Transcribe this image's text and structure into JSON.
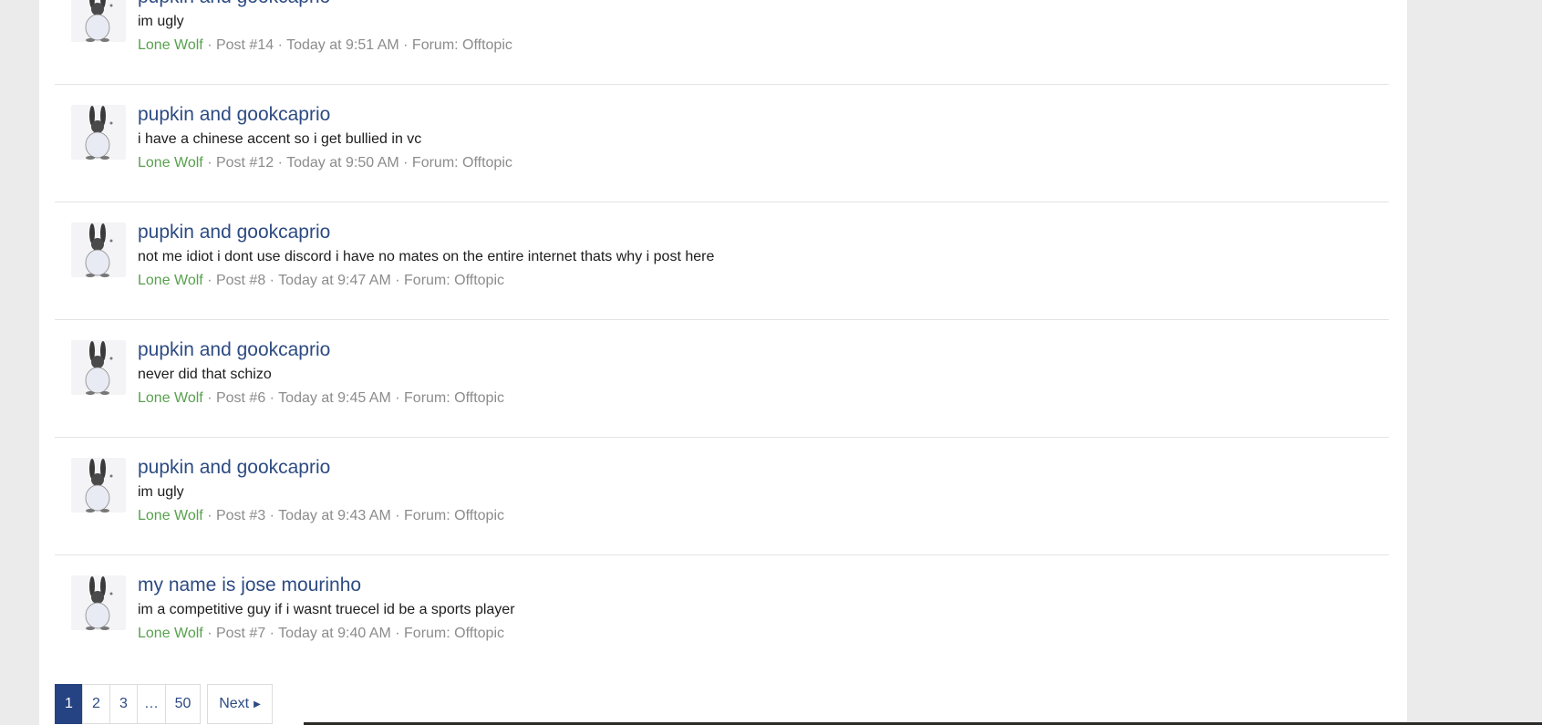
{
  "results": [
    {
      "title": "pupkin and gookcaprio",
      "snippet": "im ugly",
      "author": "Lone Wolf",
      "post": "Post #14",
      "time": "Today at 9:51 AM",
      "forum": "Forum: Offtopic"
    },
    {
      "title": "pupkin and gookcaprio",
      "snippet": "i have a chinese accent so i get bullied in vc",
      "author": "Lone Wolf",
      "post": "Post #12",
      "time": "Today at 9:50 AM",
      "forum": "Forum: Offtopic"
    },
    {
      "title": "pupkin and gookcaprio",
      "snippet": "not me idiot i dont use discord i have no mates on the entire internet thats why i post here",
      "author": "Lone Wolf",
      "post": "Post #8",
      "time": "Today at 9:47 AM",
      "forum": "Forum: Offtopic"
    },
    {
      "title": "pupkin and gookcaprio",
      "snippet": "never did that schizo",
      "author": "Lone Wolf",
      "post": "Post #6",
      "time": "Today at 9:45 AM",
      "forum": "Forum: Offtopic"
    },
    {
      "title": "pupkin and gookcaprio",
      "snippet": "im ugly",
      "author": "Lone Wolf",
      "post": "Post #3",
      "time": "Today at 9:43 AM",
      "forum": "Forum: Offtopic"
    },
    {
      "title": "my name is jose mourinho",
      "snippet": "im a competitive guy if i wasnt truecel id be a sports player",
      "author": "Lone Wolf",
      "post": "Post #7",
      "time": "Today at 9:40 AM",
      "forum": "Forum: Offtopic"
    }
  ],
  "separator": " · ",
  "avatar_icon": "rabbit-avatar-icon",
  "pagination": {
    "pages": [
      "1",
      "2",
      "3",
      "…",
      "50"
    ],
    "current": "1",
    "next_label": "Next",
    "next_icon": "caret-right-icon"
  },
  "colors": {
    "accent": "#254382",
    "link": "#2d4b82",
    "username": "#58a14e",
    "meta": "#8c8c8c"
  }
}
